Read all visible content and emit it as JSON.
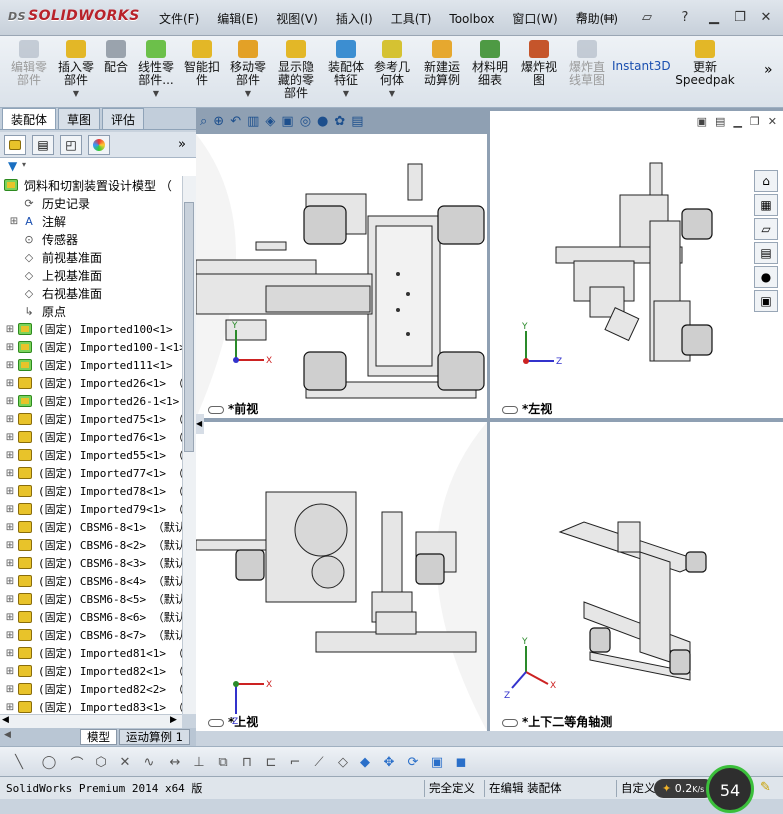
{
  "app": {
    "logo": "SOLIDWORKS",
    "logo_prefix": "DS"
  },
  "menu": [
    "文件(F)",
    "编辑(E)",
    "视图(V)",
    "插入(I)",
    "工具(T)",
    "Toolbox",
    "窗口(W)",
    "帮助(H)"
  ],
  "ribbon": [
    {
      "label": "编辑零\n部件",
      "disabled": true,
      "dropdown": false
    },
    {
      "label": "插入零\n部件",
      "disabled": false,
      "dropdown": true
    },
    {
      "label": "配合",
      "disabled": false,
      "dropdown": false
    },
    {
      "label": "线性零\n部件...",
      "disabled": false,
      "dropdown": true
    },
    {
      "label": "智能扣\n件",
      "disabled": false,
      "dropdown": false
    },
    {
      "label": "移动零\n部件",
      "disabled": false,
      "dropdown": true
    },
    {
      "label": "显示隐\n藏的零\n部件",
      "disabled": false,
      "dropdown": false
    },
    {
      "label": "装配体\n特征",
      "disabled": false,
      "dropdown": true
    },
    {
      "label": "参考几\n何体",
      "disabled": false,
      "dropdown": true
    },
    {
      "label": "新建运\n动算例",
      "disabled": false,
      "dropdown": false
    },
    {
      "label": "材料明\n细表",
      "disabled": false,
      "dropdown": false
    },
    {
      "label": "爆炸视\n图",
      "disabled": false,
      "dropdown": false
    },
    {
      "label": "爆炸直\n线草图",
      "disabled": true,
      "dropdown": false
    },
    {
      "label": "Instant3D",
      "disabled": false,
      "dropdown": false
    },
    {
      "label": "更新\nSpeedpak",
      "disabled": false,
      "dropdown": false
    }
  ],
  "left_tabs": [
    "装配体",
    "草图",
    "评估"
  ],
  "tree": {
    "root": "饲料和切割装置设计模型 （",
    "nodes": [
      {
        "label": "历史记录",
        "icon": "history-icon",
        "expand": false
      },
      {
        "label": "注解",
        "icon": "annotation-icon",
        "expand": true
      },
      {
        "label": "传感器",
        "icon": "sensor-icon",
        "expand": false
      },
      {
        "label": "前视基准面",
        "icon": "plane-icon",
        "expand": false
      },
      {
        "label": "上视基准面",
        "icon": "plane-icon",
        "expand": false
      },
      {
        "label": "右视基准面",
        "icon": "plane-icon",
        "expand": false
      },
      {
        "label": "原点",
        "icon": "origin-icon",
        "expand": false
      }
    ],
    "parts": [
      {
        "label": "(固定) Imported100<1> （",
        "green": true
      },
      {
        "label": "(固定) Imported100-1<1>",
        "green": true
      },
      {
        "label": "(固定) Imported111<1> （",
        "green": true
      },
      {
        "label": "(固定) Imported26<1> （",
        "green": false
      },
      {
        "label": "(固定) Imported26-1<1> （",
        "green": true
      },
      {
        "label": "(固定) Imported75<1> （",
        "green": false
      },
      {
        "label": "(固定) Imported76<1> （",
        "green": false
      },
      {
        "label": "(固定) Imported55<1> （",
        "green": false
      },
      {
        "label": "(固定) Imported77<1> （",
        "green": false
      },
      {
        "label": "(固定) Imported78<1> （",
        "green": false
      },
      {
        "label": "(固定) Imported79<1> （",
        "green": false
      },
      {
        "label": "(固定) CBSM6-8<1> （默认",
        "green": false
      },
      {
        "label": "(固定) CBSM6-8<2> （默认",
        "green": false
      },
      {
        "label": "(固定) CBSM6-8<3> （默认",
        "green": false
      },
      {
        "label": "(固定) CBSM6-8<4> （默认",
        "green": false
      },
      {
        "label": "(固定) CBSM6-8<5> （默认",
        "green": false
      },
      {
        "label": "(固定) CBSM6-8<6> （默认",
        "green": false
      },
      {
        "label": "(固定) CBSM6-8<7> （默认",
        "green": false
      },
      {
        "label": "(固定) Imported81<1> （",
        "green": false
      },
      {
        "label": "(固定) Imported82<1> （",
        "green": false
      },
      {
        "label": "(固定) Imported82<2> （",
        "green": false
      },
      {
        "label": "(固定) Imported83<1> （",
        "green": false
      }
    ]
  },
  "bottom_tabs": [
    "模型",
    "运动算例 1"
  ],
  "viewports": {
    "front": "*前视",
    "left": "*左视",
    "top": "*上视",
    "iso": "*上下二等角轴测"
  },
  "status": {
    "version": "SolidWorks Premium 2014 x64 版",
    "definition": "完全定义",
    "editing": "在编辑 装配体",
    "custom": "自定义",
    "speed": "0.2",
    "speed_unit": "K/s",
    "meter": "54"
  },
  "colors": {
    "accent": "#b8222a",
    "part_yellow": "#e8c32a",
    "viewport_bg": "#ffffff",
    "frame": "#8fa0b3"
  }
}
